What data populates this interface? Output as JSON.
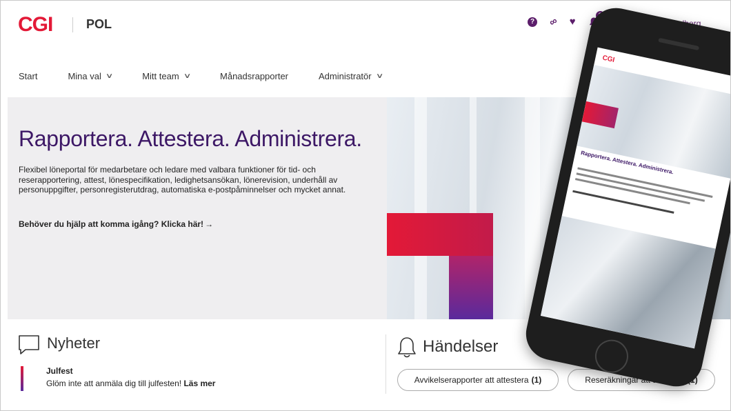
{
  "header": {
    "logo": "CGI",
    "app_name": "POL",
    "notification_count": "2",
    "user_name": "n Rydberg"
  },
  "nav": {
    "items": [
      {
        "label": "Start",
        "dropdown": false
      },
      {
        "label": "Mina val",
        "dropdown": true
      },
      {
        "label": "Mitt team",
        "dropdown": true
      },
      {
        "label": "Månadsrapporter",
        "dropdown": false
      },
      {
        "label": "Administratör",
        "dropdown": true
      }
    ]
  },
  "hero": {
    "title": "Rapportera. Attestera. Administrera.",
    "description": "Flexibel löneportal för medarbetare och ledare med valbara funktioner för tid- och reserapportering, attest, lönespecifikation, ledighetsansökan, lönerevision, underhåll av personuppgifter, personregisterutdrag, automatiska e-postpåminnelser och mycket annat.",
    "help_link": "Behöver du hjälp att komma igång? Klicka här!",
    "help_arrow": "→"
  },
  "news": {
    "title": "Nyheter",
    "item_title": "Julfest",
    "item_text": "Glöm inte att anmäla dig till julfesten!",
    "item_link": "Läs mer"
  },
  "events": {
    "title": "Händelser",
    "pill1_label": "Avvikelserapporter att attestera",
    "pill1_count": "(1)",
    "pill2_label": "Reseräkningar att attestera",
    "pill2_count": "(1)"
  },
  "colors": {
    "brand_red": "#e31937",
    "brand_purple": "#5c1e6b",
    "title_purple": "#3d1866",
    "hero_bg": "#efeef0"
  },
  "icons": {
    "help": "help-circle-icon",
    "link": "link-icon",
    "favorite": "heart-icon",
    "notifications": "bell-icon",
    "news": "speech-bubble-icon",
    "events": "bell-outline-icon",
    "dropdown": "chevron-down-icon"
  }
}
